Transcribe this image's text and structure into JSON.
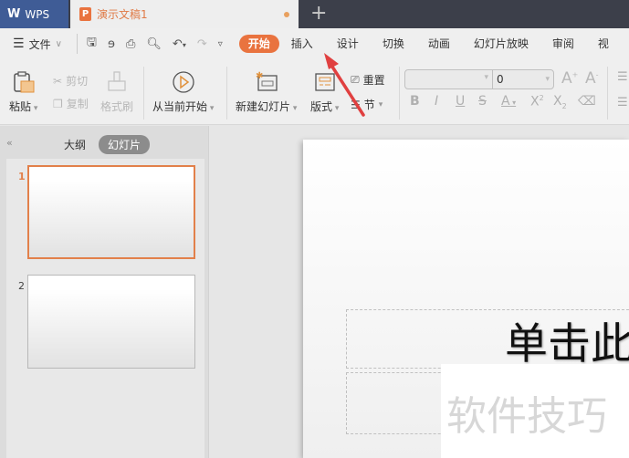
{
  "titlebar": {
    "app_label": "WPS",
    "document_tab": "演示文稿1",
    "new_tab_symbol": "+"
  },
  "menubar": {
    "file_menu": "文件",
    "tabs": [
      {
        "label": "开始",
        "active": true
      },
      {
        "label": "插入",
        "active": false
      },
      {
        "label": "设计",
        "active": false
      },
      {
        "label": "切换",
        "active": false
      },
      {
        "label": "动画",
        "active": false
      },
      {
        "label": "幻灯片放映",
        "active": false
      },
      {
        "label": "审阅",
        "active": false
      },
      {
        "label": "视",
        "active": false
      }
    ]
  },
  "ribbon": {
    "paste": "粘贴",
    "cut": "剪切",
    "copy": "复制",
    "format_painter": "格式刷",
    "from_current": "从当前开始",
    "new_slide": "新建幻灯片",
    "layout": "版式",
    "reset": "重置",
    "section": "节",
    "font_name": "",
    "font_size": "0"
  },
  "left_panel": {
    "tab_outline": "大纲",
    "tab_slides": "幻灯片",
    "slides": [
      {
        "number": "1",
        "selected": true
      },
      {
        "number": "2",
        "selected": false
      }
    ]
  },
  "slide": {
    "title_placeholder": "单击此",
    "watermark": "软件技巧"
  },
  "colors": {
    "accent": "#e9733f",
    "titlebar": "#3c3f4a",
    "wps_tab": "#3f5c96",
    "annotation_arrow": "#e04040"
  }
}
